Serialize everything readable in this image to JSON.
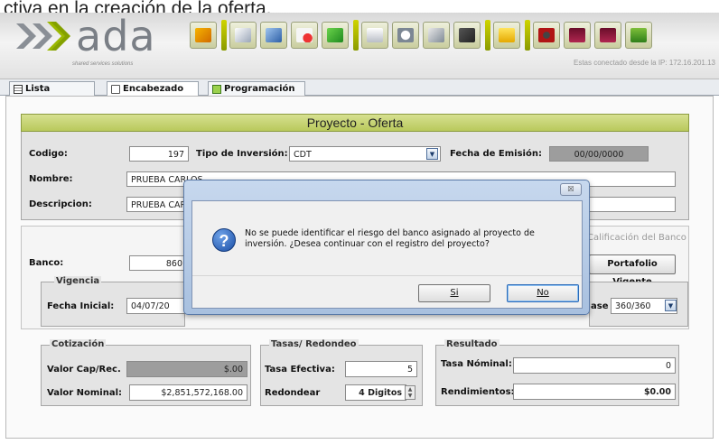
{
  "ref_text": "ctiva en la creación de la oferta.",
  "app": {
    "logo": "ada",
    "tagline": "shared services solutions",
    "connection": "Estas conectado desde la IP: 172.16.201.13"
  },
  "tabs": [
    {
      "label": "Lista"
    },
    {
      "label": "Encabezado"
    },
    {
      "label": "Programación"
    }
  ],
  "section_title": "Proyecto - Oferta",
  "form": {
    "codigo_label": "Codigo:",
    "codigo_value": "197",
    "tipo_label": "Tipo de Inversión:",
    "tipo_value": "CDT",
    "fecha_emision_label": "Fecha de Emisión:",
    "fecha_emision_value": "00/00/0000",
    "nombre_label": "Nombre:",
    "nombre_value": "PRUEBA CARLOS",
    "descripcion_label": "Descripcion:",
    "descripcion_value": "PRUEBA CARLOS",
    "calificacion_label": "Calificación del Banco",
    "banco_label": "Banco:",
    "banco_value": "860",
    "portafolio_button": "Portafolio Vigente",
    "vigencia_title": "Vigencia",
    "fecha_inicial_label": "Fecha Inicial:",
    "fecha_inicial_value": "04/07/20",
    "base_label": "ase",
    "base_value": "360/360"
  },
  "cotizacion": {
    "title": "Cotización",
    "valor_cap_label": "Valor Cap/Rec.",
    "valor_cap_value": "$.00",
    "valor_nominal_label": "Valor Nominal:",
    "valor_nominal_value": "$2,851,572,168.00"
  },
  "tasas": {
    "title": "Tasas/ Redondeo",
    "tasa_efectiva_label": "Tasa Efectiva:",
    "tasa_efectiva_value": "5",
    "redondear_label": "Redondear",
    "redondear_value": "4 Digitos"
  },
  "resultado": {
    "title": "Resultado",
    "tasa_nominal_label": "Tasa Nóminal:",
    "tasa_nominal_value": "0",
    "rendimientos_label": "Rendimientos:",
    "rendimientos_value": "$0.00"
  },
  "dialog": {
    "close_glyph": "☒",
    "icon_glyph": "?",
    "message": "No se puede identificar el riesgo del banco asignado al proyecto de inversión. ¿Desea continuar con el registro del proyecto?",
    "yes_label": "Si",
    "no_label": "No"
  },
  "colors": {
    "header_bar": "#c8d478",
    "toolbar_accent": "#b4c000",
    "dialog_frame": "#b3c9e6"
  }
}
